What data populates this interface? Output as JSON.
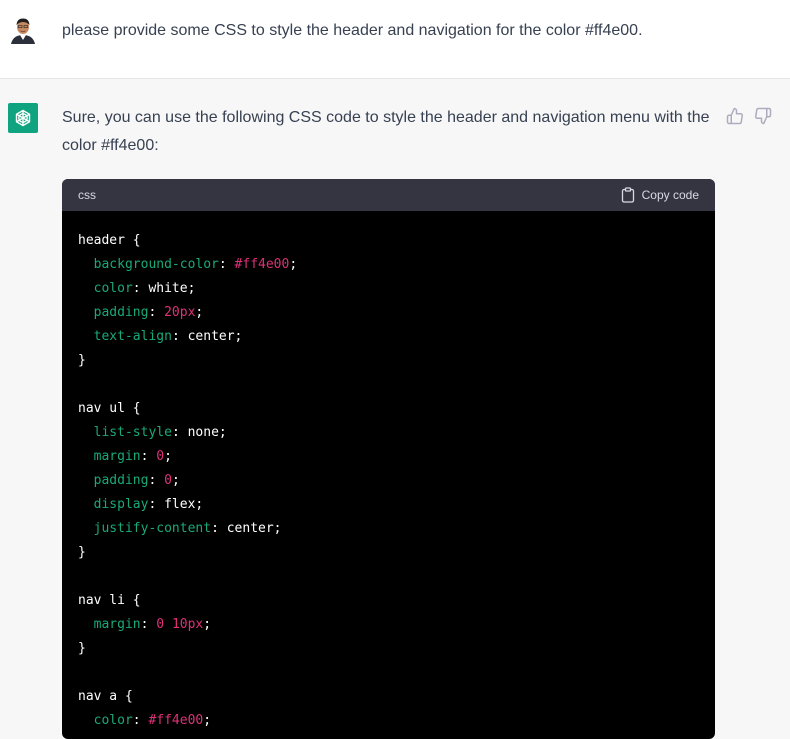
{
  "user": {
    "message": "please provide some CSS to style the header and navigation for the color #ff4e00."
  },
  "assistant": {
    "reply": "Sure, you can use the following CSS code to style the header and navigation menu with the color #ff4e00:",
    "code_block": {
      "language": "css",
      "copy_label": "Copy code",
      "lines": [
        [
          {
            "t": "plain",
            "v": "header {"
          }
        ],
        [
          {
            "t": "plain",
            "v": "  "
          },
          {
            "t": "prop",
            "v": "background-color"
          },
          {
            "t": "plain",
            "v": ": "
          },
          {
            "t": "num",
            "v": "#ff4e00"
          },
          {
            "t": "plain",
            "v": ";"
          }
        ],
        [
          {
            "t": "plain",
            "v": "  "
          },
          {
            "t": "prop",
            "v": "color"
          },
          {
            "t": "plain",
            "v": ": white;"
          }
        ],
        [
          {
            "t": "plain",
            "v": "  "
          },
          {
            "t": "prop",
            "v": "padding"
          },
          {
            "t": "plain",
            "v": ": "
          },
          {
            "t": "num",
            "v": "20px"
          },
          {
            "t": "plain",
            "v": ";"
          }
        ],
        [
          {
            "t": "plain",
            "v": "  "
          },
          {
            "t": "prop",
            "v": "text-align"
          },
          {
            "t": "plain",
            "v": ": center;"
          }
        ],
        [
          {
            "t": "plain",
            "v": "}"
          }
        ],
        [
          {
            "t": "plain",
            "v": ""
          }
        ],
        [
          {
            "t": "plain",
            "v": "nav ul {"
          }
        ],
        [
          {
            "t": "plain",
            "v": "  "
          },
          {
            "t": "prop",
            "v": "list-style"
          },
          {
            "t": "plain",
            "v": ": none;"
          }
        ],
        [
          {
            "t": "plain",
            "v": "  "
          },
          {
            "t": "prop",
            "v": "margin"
          },
          {
            "t": "plain",
            "v": ": "
          },
          {
            "t": "num",
            "v": "0"
          },
          {
            "t": "plain",
            "v": ";"
          }
        ],
        [
          {
            "t": "plain",
            "v": "  "
          },
          {
            "t": "prop",
            "v": "padding"
          },
          {
            "t": "plain",
            "v": ": "
          },
          {
            "t": "num",
            "v": "0"
          },
          {
            "t": "plain",
            "v": ";"
          }
        ],
        [
          {
            "t": "plain",
            "v": "  "
          },
          {
            "t": "prop",
            "v": "display"
          },
          {
            "t": "plain",
            "v": ": flex;"
          }
        ],
        [
          {
            "t": "plain",
            "v": "  "
          },
          {
            "t": "prop",
            "v": "justify-content"
          },
          {
            "t": "plain",
            "v": ": center;"
          }
        ],
        [
          {
            "t": "plain",
            "v": "}"
          }
        ],
        [
          {
            "t": "plain",
            "v": ""
          }
        ],
        [
          {
            "t": "plain",
            "v": "nav li {"
          }
        ],
        [
          {
            "t": "plain",
            "v": "  "
          },
          {
            "t": "prop",
            "v": "margin"
          },
          {
            "t": "plain",
            "v": ": "
          },
          {
            "t": "num",
            "v": "0"
          },
          {
            "t": "plain",
            "v": " "
          },
          {
            "t": "num",
            "v": "10px"
          },
          {
            "t": "plain",
            "v": ";"
          }
        ],
        [
          {
            "t": "plain",
            "v": "}"
          }
        ],
        [
          {
            "t": "plain",
            "v": ""
          }
        ],
        [
          {
            "t": "plain",
            "v": "nav a {"
          }
        ],
        [
          {
            "t": "plain",
            "v": "  "
          },
          {
            "t": "prop",
            "v": "color"
          },
          {
            "t": "plain",
            "v": ": "
          },
          {
            "t": "num",
            "v": "#ff4e00"
          },
          {
            "t": "plain",
            "v": ";"
          }
        ]
      ]
    }
  },
  "icons": {
    "user_avatar": "user-avatar",
    "bot_avatar": "openai-logo-icon",
    "copy": "clipboard-icon",
    "thumbs_up": "thumbs-up-icon",
    "thumbs_down": "thumbs-down-icon"
  },
  "colors": {
    "bot_avatar_bg": "#10a37f",
    "code_bg": "#000000",
    "code_header_bg": "#343541",
    "property": "#19a97b",
    "number": "#df3079",
    "assistant_row_bg": "#f7f7f8"
  }
}
